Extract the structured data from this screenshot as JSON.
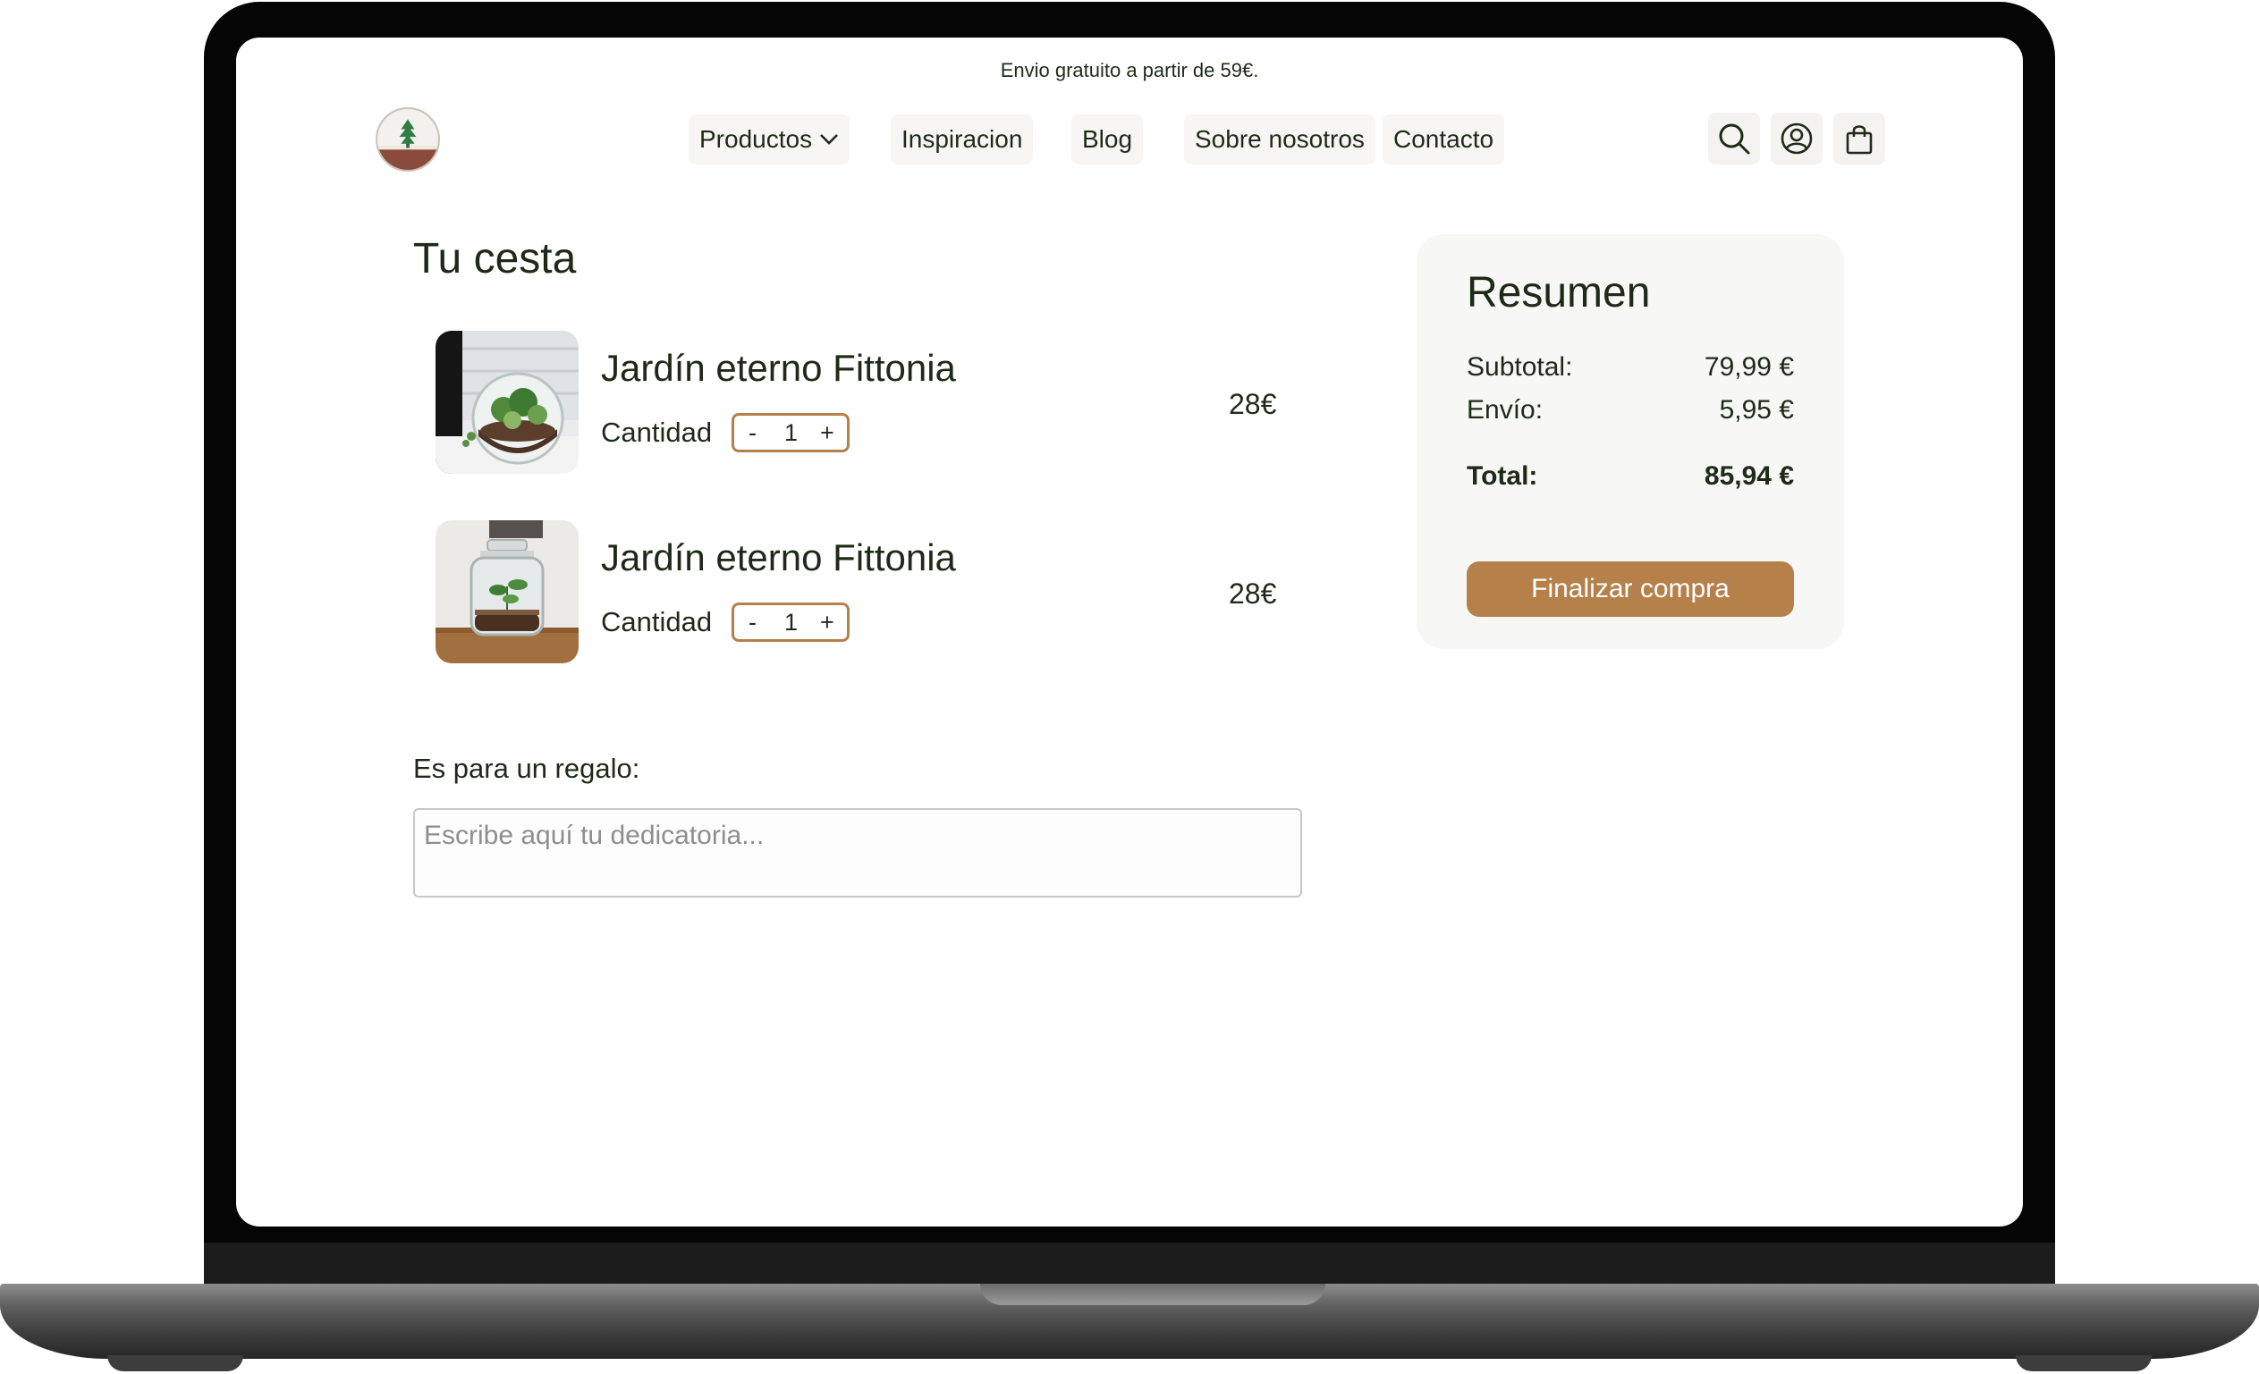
{
  "announcement": "Envio gratuito a partir de 59€.",
  "nav": {
    "items": [
      {
        "label": "Productos"
      },
      {
        "label": "Inspiracion"
      },
      {
        "label": "Blog"
      },
      {
        "label": "Sobre nosotros"
      },
      {
        "label": "Contacto"
      }
    ]
  },
  "icons": {
    "search": "search-icon",
    "account": "user-icon",
    "cart": "shopping-bag-icon",
    "dropdown": "chevron-down-icon",
    "logo": "tree-logo-icon"
  },
  "cart": {
    "title": "Tu cesta",
    "quantity_label": "Cantidad",
    "decrement": "-",
    "increment": "+",
    "items": [
      {
        "name": "Jardín eterno Fittonia",
        "quantity": "1",
        "price": "28€"
      },
      {
        "name": "Jardín eterno Fittonia",
        "quantity": "1",
        "price": "28€"
      }
    ]
  },
  "gift": {
    "label": "Es para un regalo:",
    "placeholder": "Escribe aquí tu dedicatoria..."
  },
  "summary": {
    "title": "Resumen",
    "subtotal_label": "Subtotal:",
    "subtotal_value": "79,99 €",
    "shipping_label": "Envío:",
    "shipping_value": "5,95 €",
    "total_label": "Total:",
    "total_value": "85,94 €",
    "checkout_label": "Finalizar compra"
  },
  "colors": {
    "accent": "#b5804a",
    "text": "#1e2a17",
    "summary_bg": "#f7f7f6",
    "nav_bg": "#f7f6f4"
  }
}
